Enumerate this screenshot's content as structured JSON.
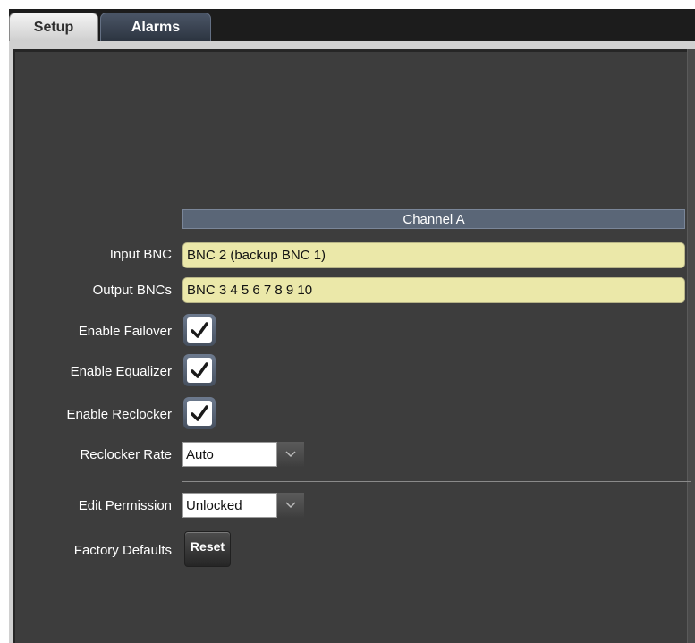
{
  "tabs": [
    {
      "label": "Setup",
      "active": true
    },
    {
      "label": "Alarms",
      "active": false
    }
  ],
  "channel_header": "Channel A",
  "fields": {
    "input_bnc": {
      "label": "Input BNC",
      "value": "BNC 2 (backup BNC 1)"
    },
    "output_bncs": {
      "label": "Output BNCs",
      "value": "BNC 3 4 5 6 7 8 9 10"
    },
    "enable_failover": {
      "label": "Enable Failover",
      "checked": true
    },
    "enable_equalizer": {
      "label": "Enable Equalizer",
      "checked": true
    },
    "enable_reclocker": {
      "label": "Enable Reclocker",
      "checked": true
    },
    "reclocker_rate": {
      "label": "Reclocker Rate",
      "value": "Auto"
    },
    "edit_permission": {
      "label": "Edit Permission",
      "value": "Unlocked"
    },
    "factory_defaults": {
      "label": "Factory Defaults",
      "button": "Reset"
    }
  },
  "colors": {
    "panel_background": "#3d3d3d",
    "field_background": "#ebe8a9",
    "header_background": "#5a6677",
    "checkbox_frame": "#5a6677"
  },
  "icons": {
    "checkbox": "checkmark-icon",
    "dropdown": "chevron-down-icon"
  }
}
